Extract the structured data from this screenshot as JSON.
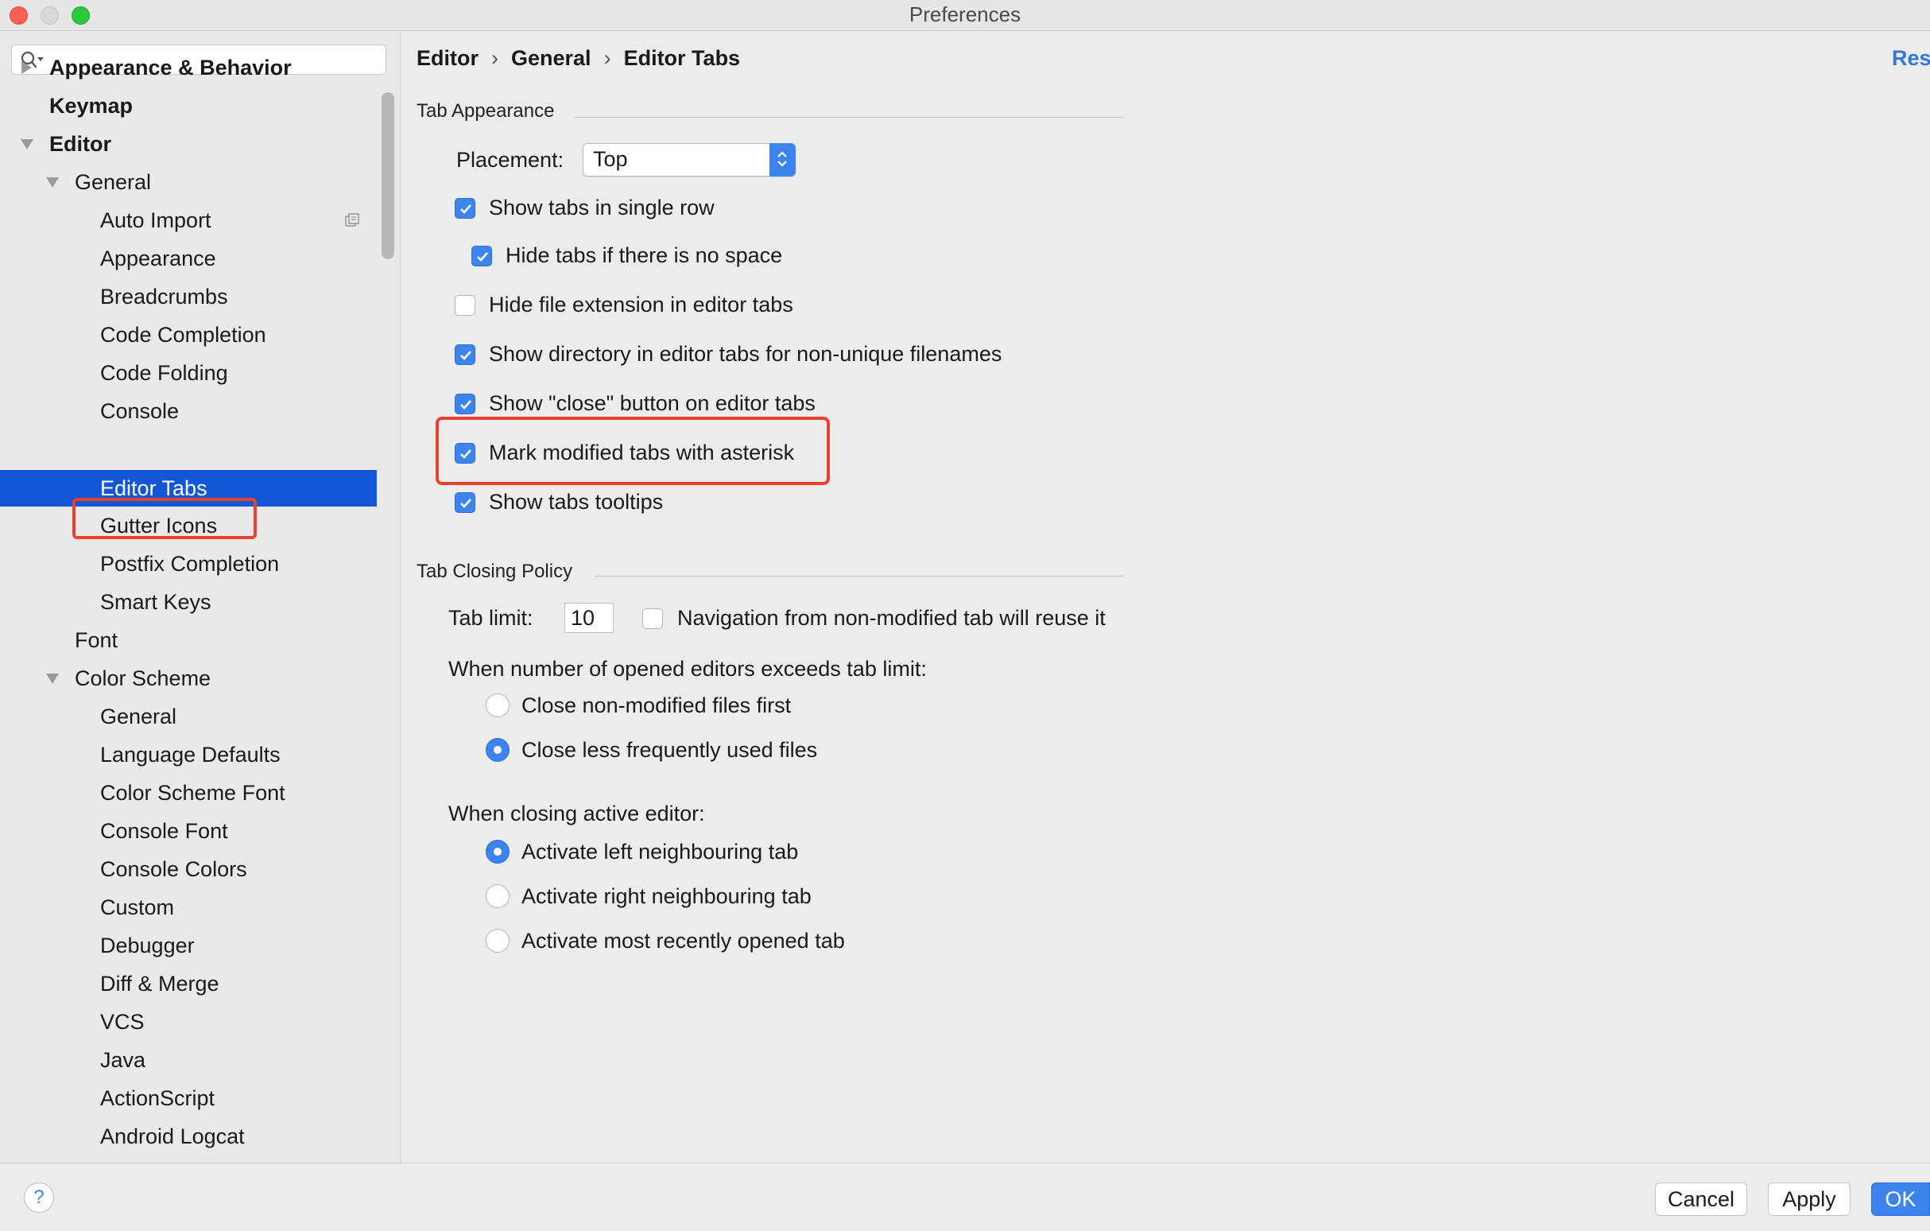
{
  "window": {
    "title": "Preferences"
  },
  "sidebar": {
    "search_placeholder": "",
    "items": [
      {
        "label": "Appearance & Behavior"
      },
      {
        "label": "Keymap"
      },
      {
        "label": "Editor"
      },
      {
        "label": "General"
      },
      {
        "label": "Auto Import"
      },
      {
        "label": "Appearance"
      },
      {
        "label": "Breadcrumbs"
      },
      {
        "label": "Code Completion"
      },
      {
        "label": "Code Folding"
      },
      {
        "label": "Console"
      },
      {
        "label": "Editor Tabs"
      },
      {
        "label": "Gutter Icons"
      },
      {
        "label": "Postfix Completion"
      },
      {
        "label": "Smart Keys"
      },
      {
        "label": "Font"
      },
      {
        "label": "Color Scheme"
      },
      {
        "label": "General"
      },
      {
        "label": "Language Defaults"
      },
      {
        "label": "Color Scheme Font"
      },
      {
        "label": "Console Font"
      },
      {
        "label": "Console Colors"
      },
      {
        "label": "Custom"
      },
      {
        "label": "Debugger"
      },
      {
        "label": "Diff & Merge"
      },
      {
        "label": "VCS"
      },
      {
        "label": "Java"
      },
      {
        "label": "ActionScript"
      },
      {
        "label": "Android Logcat"
      }
    ],
    "selected": "Editor Tabs"
  },
  "breadcrumb": [
    "Editor",
    "General",
    "Editor Tabs"
  ],
  "breadcrumb_separator": "›",
  "reset_label": "Res",
  "tab_appearance": {
    "title": "Tab Appearance",
    "placement_label": "Placement:",
    "placement_value": "Top",
    "options": [
      {
        "label": "Show tabs in single row",
        "checked": true
      },
      {
        "label": "Hide tabs if there is no space",
        "checked": true
      },
      {
        "label": "Hide file extension in editor tabs",
        "checked": false
      },
      {
        "label": "Show directory in editor tabs for non-unique filenames",
        "checked": true
      },
      {
        "label": "Show \"close\" button on editor tabs",
        "checked": true
      },
      {
        "label": "Mark modified tabs with asterisk",
        "checked": true
      },
      {
        "label": "Show tabs tooltips",
        "checked": true
      }
    ]
  },
  "tab_closing": {
    "title": "Tab Closing Policy",
    "tab_limit_label": "Tab limit:",
    "tab_limit_value": "10",
    "reuse_label": "Navigation from non-modified tab will reuse it",
    "reuse_checked": false,
    "exceeds_label": "When number of opened editors exceeds tab limit:",
    "exceeds_options": [
      {
        "label": "Close non-modified files first",
        "selected": false
      },
      {
        "label": "Close less frequently used files",
        "selected": true
      }
    ],
    "closing_label": "When closing active editor:",
    "closing_options": [
      {
        "label": "Activate left neighbouring tab",
        "selected": true
      },
      {
        "label": "Activate right neighbouring tab",
        "selected": false
      },
      {
        "label": "Activate most recently opened tab",
        "selected": false
      }
    ]
  },
  "footer": {
    "help_label": "?",
    "cancel_label": "Cancel",
    "apply_label": "Apply",
    "ok_label": "OK"
  },
  "colors": {
    "accent": "#3d85ec",
    "selection": "#1457d6",
    "highlight": "#e8412c",
    "link": "#2f7ad8"
  }
}
